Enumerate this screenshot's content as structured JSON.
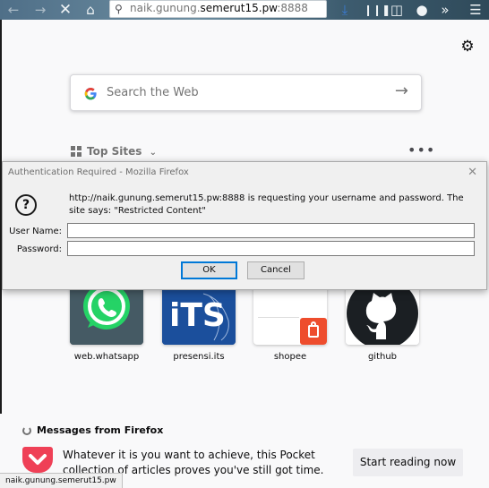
{
  "toolbar": {
    "url_host": "naik.gunung.",
    "url_domain": "semerut15.pw",
    "url_port": ":8888",
    "icons": [
      "back-icon",
      "forward-icon",
      "stop-icon",
      "home-icon",
      "info-icon",
      "download-icon",
      "library-icon",
      "sidebar-icon",
      "account-icon",
      "overflow-icon",
      "menu-icon"
    ]
  },
  "newtab": {
    "search_placeholder": "Search the Web",
    "top_sites_label": "Top Sites",
    "more_label": "•••",
    "tiles": [
      {
        "label": "web.whatsapp"
      },
      {
        "label": "presensi.its"
      },
      {
        "label": "shopee"
      },
      {
        "label": "github"
      }
    ],
    "tile_texts": {
      "its_logo": "iTS"
    }
  },
  "dialog": {
    "title": "Authentication Required - Mozilla Firefox",
    "message": "http://naik.gunung.semerut15.pw:8888 is requesting your username and password. The site says: \"Restricted Content\"",
    "username_label": "User Name:",
    "password_label": "Password:",
    "ok_label": "OK",
    "cancel_label": "Cancel"
  },
  "pocket": {
    "header": "Messages from Firefox",
    "text": "Whatever it is you want to achieve, this Pocket collection of articles proves you've still got time.",
    "button": "Start reading now"
  },
  "status_bar": {
    "text": "naik.gunung.semerut15.pw"
  },
  "colors": {
    "accent": "#0078d7",
    "pocket": "#ef4056",
    "whatsapp": "#25d366",
    "its_blue": "#1b4f9c",
    "shopee": "#ee4d2d"
  }
}
